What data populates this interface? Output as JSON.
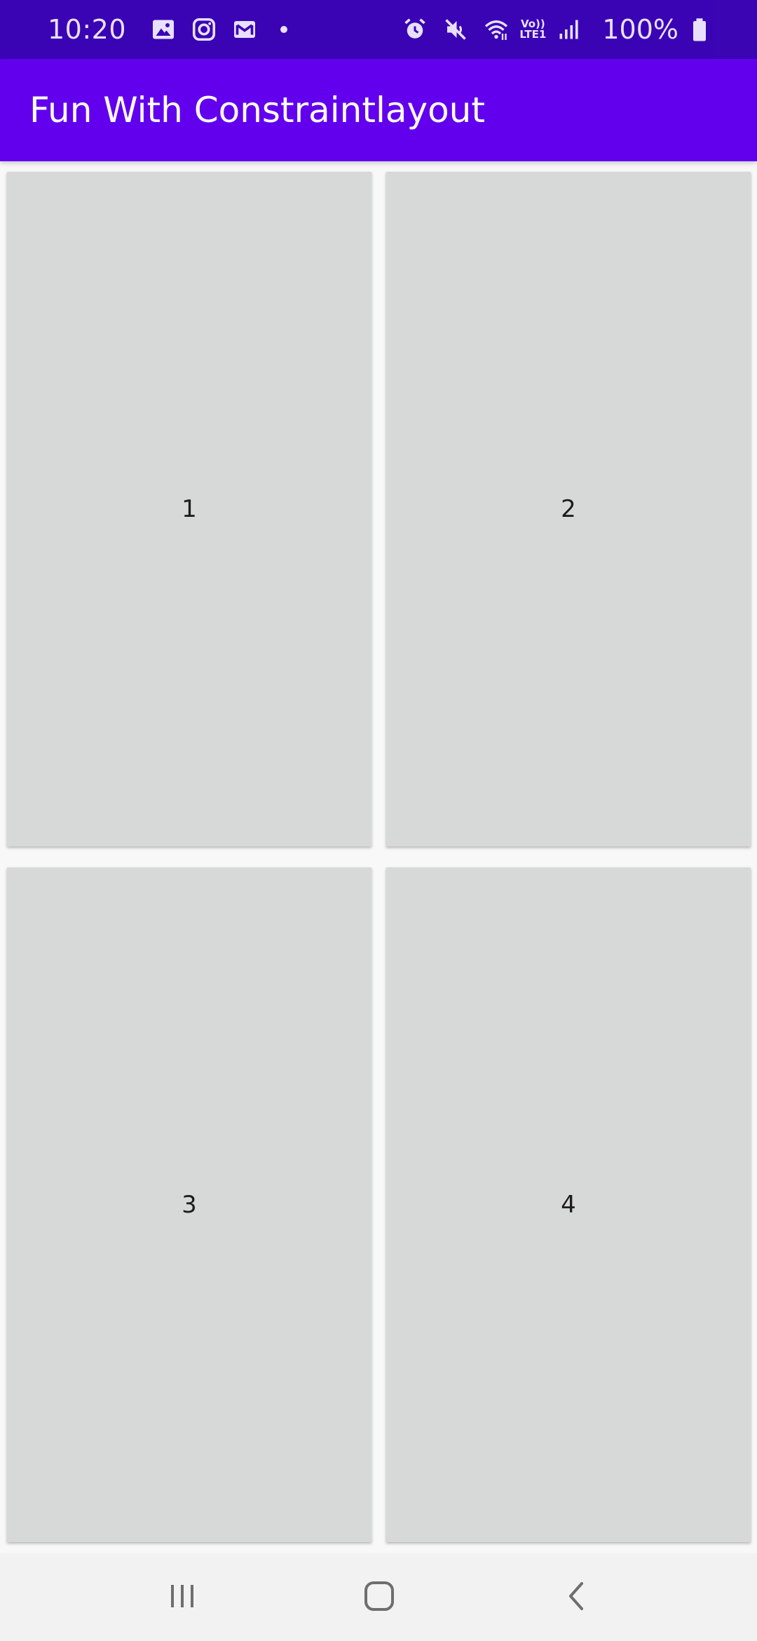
{
  "status_bar": {
    "time": "10:20",
    "battery": "100%",
    "network_label_top": "Vo))",
    "network_label_bottom": "LTE1",
    "left_icons": [
      "gallery-icon",
      "instagram-icon",
      "gmail-icon",
      "notification-dot"
    ],
    "right_icons": [
      "alarm-icon",
      "mute-icon",
      "wifi-icon",
      "signal-icon",
      "battery-icon"
    ]
  },
  "app_bar": {
    "title": "Fun With Constraintlayout",
    "color": "#6200ee"
  },
  "cards": [
    {
      "label": "1"
    },
    {
      "label": "2"
    },
    {
      "label": "3"
    },
    {
      "label": "4"
    }
  ],
  "nav_bar": {
    "buttons": [
      "recents-icon",
      "home-icon",
      "back-icon"
    ]
  },
  "colors": {
    "status_bar": "#3700b3",
    "app_bar": "#6200ee",
    "card": "#d7d8d8",
    "background": "#f8f8f8"
  }
}
